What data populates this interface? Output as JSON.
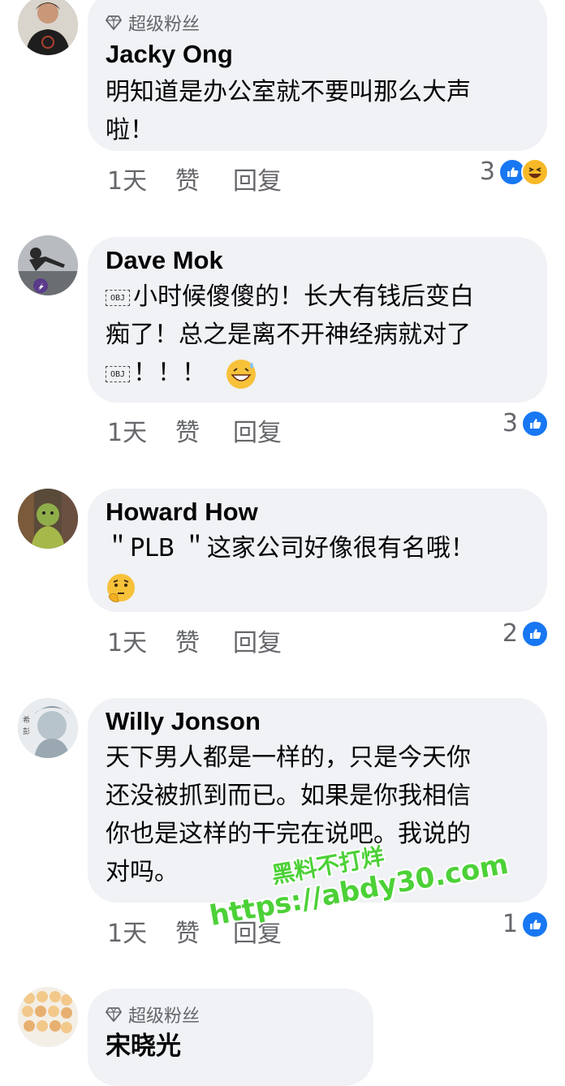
{
  "comments": [
    {
      "badge": "超级粉丝",
      "name": "Jacky Ong",
      "text_lines": [
        "明知道是办公室就不要叫那么大声",
        "啦！"
      ],
      "time": "1天",
      "like": "赞",
      "reply": "回复",
      "reaction_count": "3",
      "reactions": [
        "like-icon",
        "haha-icon"
      ]
    },
    {
      "name": "Dave Mok",
      "text_lines": [
        "小时候傻傻的！长大有钱后变白",
        "痴了！总之是离不开神经病就对了",
        "！！！"
      ],
      "obj_label": "OBJ",
      "time": "1天",
      "like": "赞",
      "reply": "回复",
      "reaction_count": "3",
      "reactions": [
        "like-icon"
      ]
    },
    {
      "name": "Howard How",
      "text_lines": [
        "＂PLB ＂这家公司好像很有名哦！"
      ],
      "time": "1天",
      "like": "赞",
      "reply": "回复",
      "reaction_count": "2",
      "reactions": [
        "like-icon"
      ]
    },
    {
      "name": "Willy Jonson",
      "text_lines": [
        "天下男人都是一样的，只是今天你",
        "还没被抓到而已。如果是你我相信",
        "你也是这样的干完在说吧。我说的",
        "对吗。"
      ],
      "time": "1天",
      "like": "赞",
      "reply": "回复",
      "reaction_count": "1",
      "reactions": [
        "like-icon"
      ]
    },
    {
      "badge": "超级粉丝",
      "name": "宋晓光"
    }
  ],
  "watermark": {
    "line1": "黑料不打烊",
    "line2": "https://abdy30.com"
  },
  "colors": {
    "bubble": "#f0f2f5",
    "meta": "#65676b",
    "like_blue": "#1877f2",
    "watermark_green": "#4cd137"
  }
}
